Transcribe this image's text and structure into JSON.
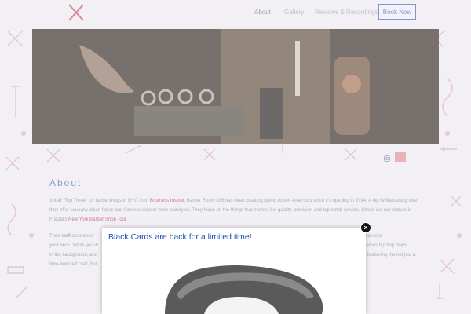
{
  "nav": {
    "items": [
      {
        "label": "About",
        "active": true
      },
      {
        "label": "Gallery",
        "active": false
      },
      {
        "label": "Reviews & Recordings",
        "active": false
      }
    ],
    "book_label": "Book Now"
  },
  "about": {
    "title": "About",
    "p1_a": "Voted \"Top Three\" for barbershops in NYC from ",
    "p1_link1": "Business Insider",
    "p1_b": ", Barber Room 306 has been creating giving expert-level cuts since it's opening in 2014. A hip Williamsburg vibe, they offer squeaky-clean fades and flawless scissor-work hairstyles. They focus on the things that matter, like quality, precision and top notch service. Check out our feature in Fractal's ",
    "p1_link2": "New York Barber Shop Tour",
    "p1_c": ".",
    "p2_line1": "Their staff consists of",
    "p2_line1_end": "hot towel around",
    "p2_line2": "your neck. While you w",
    "p2_line2_end": "hemes hip hop plays",
    "p2_line3": "in the background, and",
    "p2_line3_end": "barbering the not just a",
    "p2_line4": "time-honored craft, but"
  },
  "popup": {
    "message": "Black Cards are back for a limited time!",
    "close_symbol": "×"
  },
  "colors": {
    "accent": "#3c5bb8",
    "link": "#b03050",
    "popup_text": "#1a4fb5"
  },
  "icons": [
    "scissors-logo-icon",
    "instagram-icon",
    "facebook-icon",
    "close-icon"
  ]
}
